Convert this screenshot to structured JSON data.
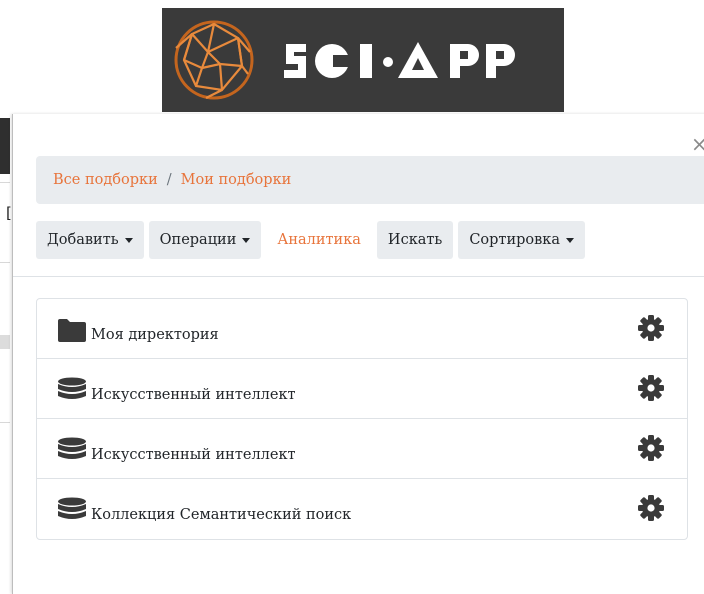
{
  "logo": {
    "text": "SCI·APP"
  },
  "background": {
    "bracket": "["
  },
  "modal": {
    "close_label": "×",
    "breadcrumb": {
      "root": "Все подборки",
      "separator": "/",
      "current": "Мои подборки"
    },
    "toolbar": {
      "add": "Добавить",
      "operations": "Операции",
      "analytics": "Аналитика",
      "search": "Искать",
      "sort": "Сортировка"
    },
    "items": [
      {
        "label": "Моя директория",
        "icon": "folder-icon"
      },
      {
        "label": "Искусственный интеллект",
        "icon": "database-icon"
      },
      {
        "label": "Искусственный интеллект",
        "icon": "database-icon"
      },
      {
        "label": "Коллекция Семантический поиск",
        "icon": "database-icon"
      }
    ]
  },
  "colors": {
    "accent": "#e8743b",
    "breadcrumb_bg": "#e9ecef",
    "icon": "#3a3a3a",
    "logo_bg": "#3a3a3a"
  }
}
